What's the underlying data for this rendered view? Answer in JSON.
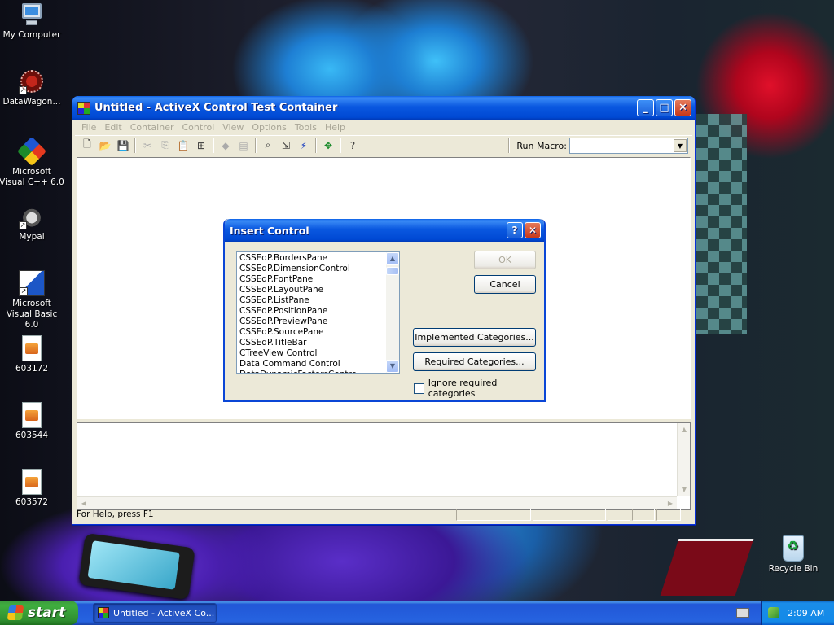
{
  "desktop": {
    "icons": [
      {
        "label": "My Computer"
      },
      {
        "label": "DataWagon..."
      },
      {
        "label": "Microsoft Visual C++ 6.0"
      },
      {
        "label": "Mypal"
      },
      {
        "label": "Microsoft Visual Basic 6.0"
      },
      {
        "label": "603172"
      },
      {
        "label": "603544"
      },
      {
        "label": "603572"
      },
      {
        "label": "Recycle Bin"
      }
    ]
  },
  "main_window": {
    "title": "Untitled - ActiveX Control Test Container",
    "menu": [
      "File",
      "Edit",
      "Container",
      "Control",
      "View",
      "Options",
      "Tools",
      "Help"
    ],
    "run_macro_label": "Run Macro:",
    "run_macro_value": "",
    "status_text": "For Help, press F1"
  },
  "dialog": {
    "title": "Insert Control",
    "controls_list": [
      "CSSEdP.BordersPane",
      "CSSEdP.DimensionControl",
      "CSSEdP.FontPane",
      "CSSEdP.LayoutPane",
      "CSSEdP.ListPane",
      "CSSEdP.PositionPane",
      "CSSEdP.PreviewPane",
      "CSSEdP.SourcePane",
      "CSSEdP.TitleBar",
      "CTreeView Control",
      "Data Command Control",
      "DataDynamicFactorsControl"
    ],
    "ok_label": "OK",
    "cancel_label": "Cancel",
    "implemented_label": "Implemented Categories...",
    "required_label": "Required Categories...",
    "ignore_label": "Ignore required categories",
    "ignore_checked": false
  },
  "taskbar": {
    "start_label": "start",
    "task_label": "Untitled - ActiveX Co...",
    "clock": "2:09 AM"
  },
  "colors": {
    "title_blue": "#0a58e0",
    "start_green": "#3fae3f",
    "taskbar_blue": "#2663e0"
  }
}
